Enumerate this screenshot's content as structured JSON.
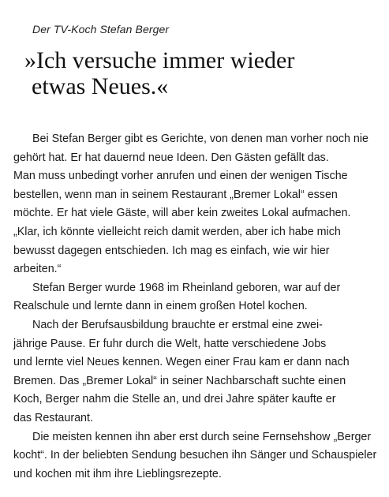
{
  "article": {
    "kicker": "Der TV-Koch Stefan Berger",
    "headline_lines": [
      "»Ich versuche immer wieder",
      "etwas Neues.«"
    ],
    "body_lines": [
      "Bei Stefan Berger gibt es Gerichte, von denen man vorher noch nie",
      "gehört hat. Er hat dauernd neue Ideen. Den Gästen gefällt das.",
      "Man muss unbedingt vorher anrufen und einen der wenigen Tische",
      "bestellen, wenn man in seinem Restaurant „Bremer Lokal“ essen",
      "möchte. Er hat viele Gäste, will aber kein zweites Lokal aufmachen.",
      "„Klar, ich könnte vielleicht reich damit werden, aber ich habe mich",
      "bewusst dagegen entschieden. Ich mag es einfach, wie wir hier",
      "arbeiten.“",
      "Stefan Berger wurde 1968 im Rheinland geboren, war auf der",
      "Realschule und lernte dann in einem großen Hotel kochen.",
      "Nach der Berufsausbildung brauchte er erstmal eine zwei-",
      "jährige Pause. Er fuhr durch die Welt, hatte verschiedene Jobs",
      "und lernte viel Neues kennen. Wegen einer Frau kam er dann nach",
      "Bremen. Das „Bremer Lokal“ in seiner Nachbarschaft suchte einen",
      "Koch, Berger nahm die Stelle an, und drei Jahre später kaufte er",
      "das Restaurant.",
      "Die meisten kennen ihn aber erst durch seine Fernsehshow „Berger",
      "kocht“. In der beliebten Sendung besuchen ihn Sänger und Schauspieler",
      "und kochen mit ihm ihre Lieblingsrezepte."
    ]
  }
}
